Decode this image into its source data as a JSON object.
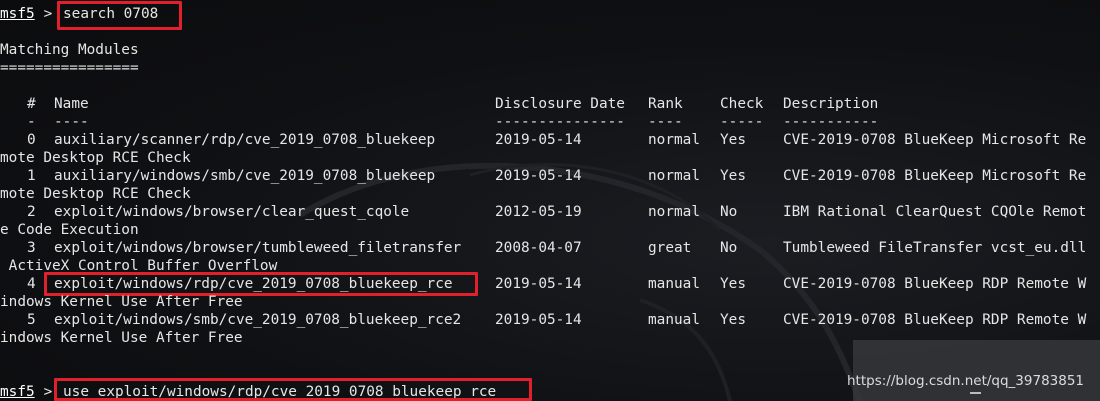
{
  "colors": {
    "background": "#0e0f12",
    "text": "#e6e6e6",
    "highlight": "#e0212b"
  },
  "line1": {
    "prompt": "msf5",
    "sep": " > ",
    "command": "search 0708"
  },
  "heading": "Matching Modules",
  "heading_rule": "================",
  "headers": {
    "num": "#",
    "name": "Name",
    "date": "Disclosure Date",
    "rank": "Rank",
    "check": "Check",
    "desc": "Description"
  },
  "rules": {
    "num": "-",
    "name": "----",
    "date": "---------------",
    "rank": "----",
    "check": "-----",
    "desc": "-----------"
  },
  "rows": [
    {
      "num": "0",
      "name": "auxiliary/scanner/rdp/cve_2019_0708_bluekeep",
      "date": "2019-05-14",
      "rank": "normal",
      "check": "Yes",
      "desc": "CVE-2019-0708 BlueKeep Microsoft Re",
      "wrap": "mote Desktop RCE Check"
    },
    {
      "num": "1",
      "name": "auxiliary/windows/smb/cve_2019_0708_bluekeep",
      "date": "2019-05-14",
      "rank": "normal",
      "check": "Yes",
      "desc": "CVE-2019-0708 BlueKeep Microsoft Re",
      "wrap": "mote Desktop RCE Check"
    },
    {
      "num": "2",
      "name": "exploit/windows/browser/clear_quest_cqole",
      "date": "2012-05-19",
      "rank": "normal",
      "check": "No",
      "desc": "IBM Rational ClearQuest CQOle Remot",
      "wrap": "e Code Execution"
    },
    {
      "num": "3",
      "name": "exploit/windows/browser/tumbleweed_filetransfer",
      "date": "2008-04-07",
      "rank": "great",
      "check": "No",
      "desc": "Tumbleweed FileTransfer vcst_eu.dll",
      "wrap": " ActiveX Control Buffer Overflow"
    },
    {
      "num": "4",
      "name": "exploit/windows/rdp/cve_2019_0708_bluekeep_rce",
      "date": "2019-05-14",
      "rank": "manual",
      "check": "Yes",
      "desc": "CVE-2019-0708 BlueKeep RDP Remote W",
      "wrap": "indows Kernel Use After Free"
    },
    {
      "num": "5",
      "name": "exploit/windows/smb/cve_2019_0708_bluekeep_rce2",
      "date": "2019-05-14",
      "rank": "manual",
      "check": "Yes",
      "desc": "CVE-2019-0708 BlueKeep RDP Remote W",
      "wrap": "indows Kernel Use After Free"
    }
  ],
  "last_line": {
    "prompt": "msf5",
    "sep": " > ",
    "command": "use exploit/windows/rdp/cve_2019_0708_bluekeep_rce"
  },
  "watermark": "https://blog.csdn.net/qq_39783851"
}
